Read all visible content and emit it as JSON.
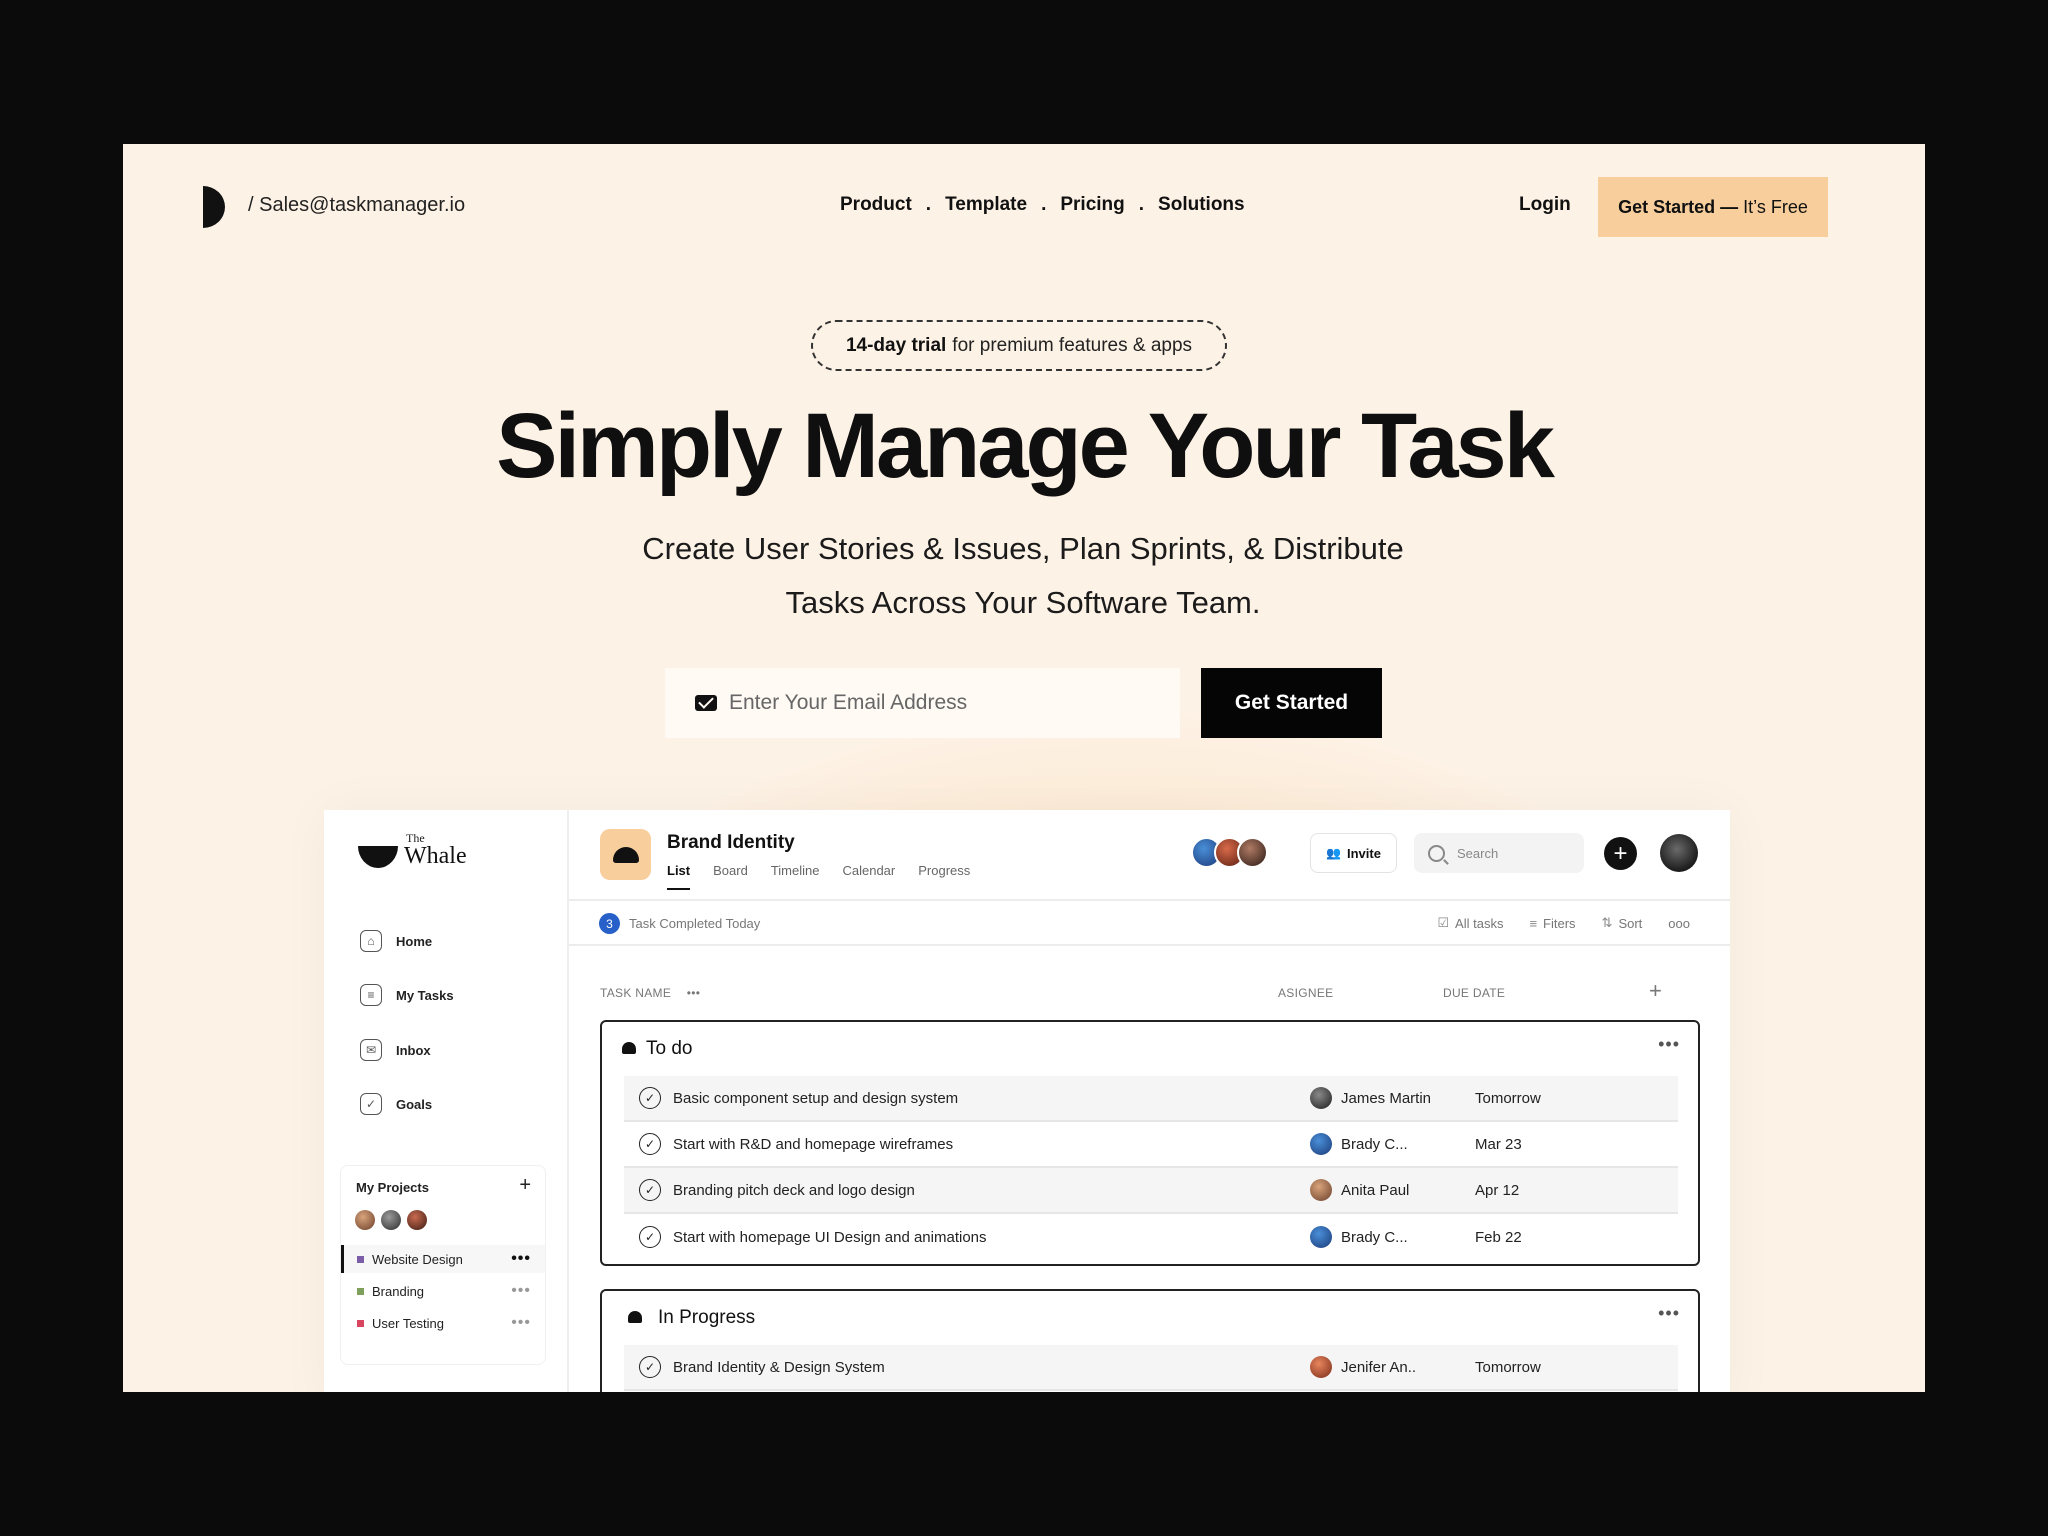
{
  "header": {
    "email": "/ Sales@taskmanager.io",
    "nav": [
      "Product",
      "Template",
      "Pricing",
      "Solutions"
    ],
    "nav_separator": ".",
    "login": "Login",
    "cta_bold": "Get Started —",
    "cta_rest": "It’s Free"
  },
  "hero": {
    "trial_bold": "14-day trial",
    "trial_rest": "for premium features & apps",
    "title": "Simply Manage Your Task",
    "subtitle_line1": "Create User Stories & Issues, Plan Sprints, & Distribute",
    "subtitle_line2": "Tasks Across Your Software Team.",
    "email_placeholder": "Enter Your Email Address",
    "cta": "Get Started"
  },
  "app": {
    "brand_the": "The",
    "brand_name": "Whale",
    "sidebar": [
      {
        "label": "Home",
        "icon": "home-icon"
      },
      {
        "label": "My Tasks",
        "icon": "document-icon"
      },
      {
        "label": "Inbox",
        "icon": "inbox-icon"
      },
      {
        "label": "Goals",
        "icon": "check-icon"
      }
    ],
    "projects": {
      "title": "My Projects",
      "add": "+",
      "items": [
        {
          "label": "Website Design",
          "color": "#7b5ea7"
        },
        {
          "label": "Branding",
          "color": "#7fa05c"
        },
        {
          "label": "User Testing",
          "color": "#d9455f"
        }
      ]
    },
    "project_title": "Brand Identity",
    "tabs": [
      "List",
      "Board",
      "Timeline",
      "Calendar",
      "Progress"
    ],
    "invite": "Invite",
    "search_placeholder": "Search",
    "completed_count": "3",
    "completed_text": "Task Completed Today",
    "filters": [
      "All tasks",
      "Fiters",
      "Sort"
    ],
    "columns": {
      "task": "TASK NAME",
      "assignee": "ASIGNEE",
      "due": "DUE DATE"
    },
    "groups": [
      {
        "title": "To do",
        "tasks": [
          {
            "name": "Basic component setup and design system",
            "assignee": "James Martin",
            "due": "Tomorrow"
          },
          {
            "name": "Start with R&D and homepage wireframes",
            "assignee": "Brady C...",
            "due": "Mar 23"
          },
          {
            "name": "Branding pitch deck and logo design",
            "assignee": "Anita Paul",
            "due": "Apr 12"
          },
          {
            "name": "Start with homepage UI Design and animations",
            "assignee": "Brady C...",
            "due": "Feb 22"
          }
        ]
      },
      {
        "title": "In Progress",
        "tasks": [
          {
            "name": "Brand Identity & Design System",
            "assignee": "Jenifer An..",
            "due": "Tomorrow"
          }
        ]
      }
    ]
  },
  "colors": {
    "background": "#fdf2e6",
    "accent": "#f8cf9c",
    "primary_button": "#050505",
    "completed_badge": "#2660c8"
  }
}
